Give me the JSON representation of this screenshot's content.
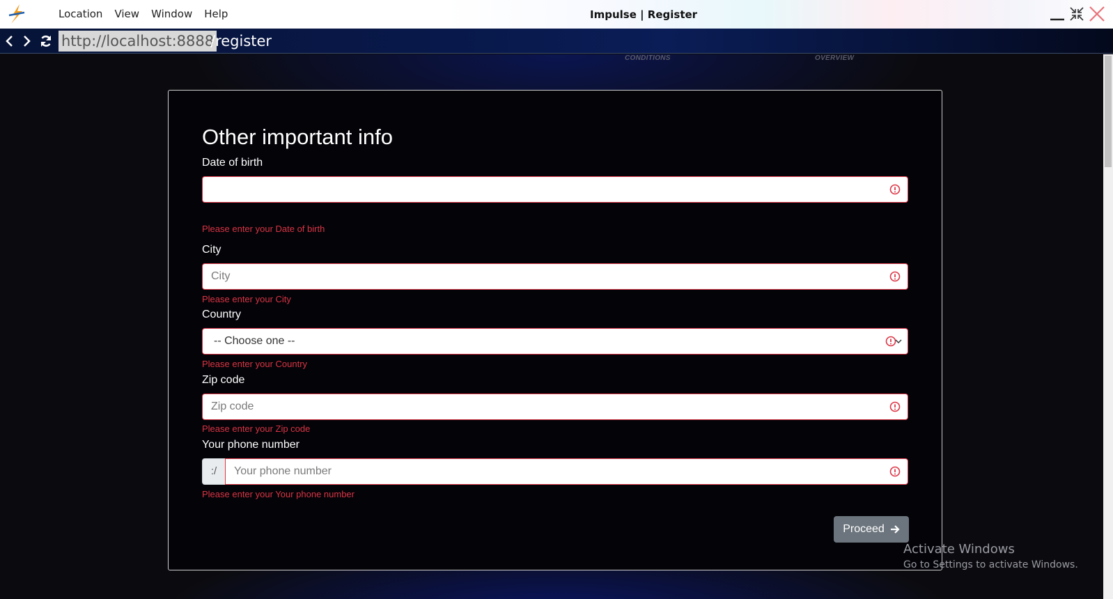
{
  "app": {
    "window_title": "Impulse | Register",
    "menu": [
      "Location",
      "View",
      "Window",
      "Help"
    ]
  },
  "address_bar": {
    "host": "http://localhost:8888",
    "path": "/register"
  },
  "steps": {
    "step_conditions": "CONDITIONS",
    "step_overview": "OVERVIEW"
  },
  "form": {
    "title": "Other important info",
    "dob": {
      "label": "Date of birth",
      "value": "",
      "error": "Please enter your Date of birth"
    },
    "city": {
      "label": "City",
      "placeholder": "City",
      "error": "Please enter your City"
    },
    "country": {
      "label": "Country",
      "selected": "-- Choose one --",
      "error": "Please enter your Country"
    },
    "zip": {
      "label": "Zip code",
      "placeholder": "Zip code",
      "error": "Please enter your Zip code"
    },
    "phone": {
      "label": "Your phone number",
      "prefix": ":/",
      "placeholder": "Your phone number",
      "error": "Please enter your Your phone number"
    },
    "proceed_label": "Proceed"
  },
  "watermark": {
    "title": "Activate Windows",
    "subtitle": "Go to Settings to activate Windows."
  },
  "colors": {
    "error": "#dc3545",
    "button": "#6c757d",
    "address_bar": "#08184a"
  }
}
